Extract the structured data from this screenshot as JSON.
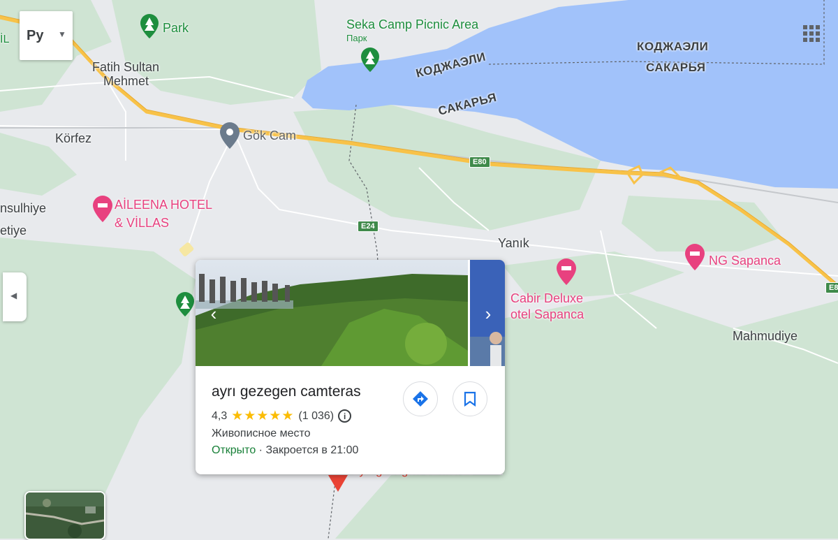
{
  "map": {
    "towns": [
      "Fatih Sultan",
      "Mehmet",
      "Körfez",
      "nsulhiye",
      "etiye",
      "Yanık",
      "Mahmudiye"
    ],
    "regions": [
      "КОДЖАЭЛИ",
      "САКАРЬЯ",
      "КОДЖАЭЛИ",
      "САКАРЬЯ"
    ],
    "pois": {
      "park": "Park",
      "seka_name": "Seka Camp Picnic Area",
      "seka_type": "Парк",
      "gok_cam": "Gök Cam",
      "aileena_1": "AİLEENA HOTEL",
      "aileena_2": "& VİLLAS",
      "ng_sapanca": "NG Sapanca",
      "cabir_1": "Cabir Deluxe",
      "cabir_2": "otel Sapanca",
      "selected_pin_label": "ayrı gezegen camteras",
      "edge_il": "İL"
    },
    "roads": {
      "e80": "E80",
      "e24": "E24",
      "e8_edge": "E8"
    },
    "colors": {
      "water": "#a1c2fa",
      "land": "#e8eaed",
      "forest": "#cde3d1",
      "highway": "#f8c248",
      "pink": "#e8417f",
      "green": "#1e8e3e"
    }
  },
  "controls": {
    "language_label": "Ру",
    "dropdown_icon": "caret-down-icon",
    "apps_icon": "apps-grid-icon",
    "collapse_icon": "chevron-left-icon",
    "layers_icon": "satellite-thumbnail"
  },
  "card": {
    "title": "ayrı gezegen camteras",
    "rating": "4,3",
    "stars": "★★★★★",
    "reviews": "(1 036)",
    "info_icon": "info-icon",
    "category": "Живописное место",
    "open_status": "Открыто",
    "hours": " · Закроется в 21:00",
    "directions_icon": "directions-icon",
    "save_icon": "bookmark-icon",
    "prev_icon": "chevron-left-icon",
    "next_icon": "chevron-right-icon"
  }
}
